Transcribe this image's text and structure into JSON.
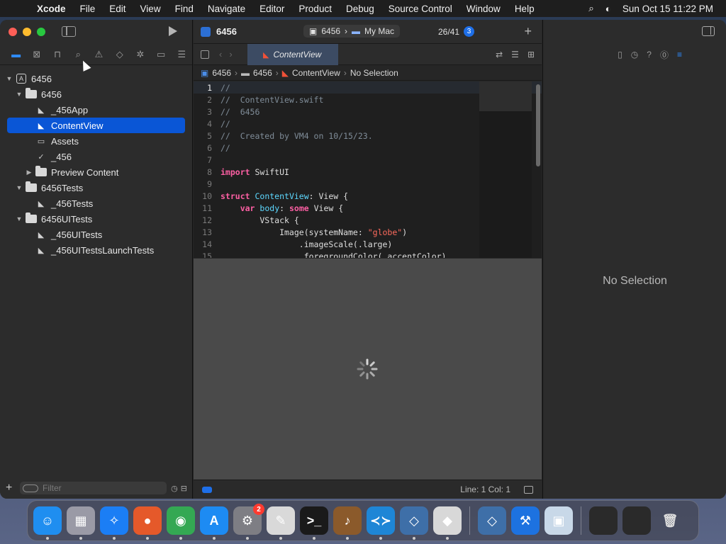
{
  "menubar": {
    "app": "Xcode",
    "items": [
      "File",
      "Edit",
      "View",
      "Find",
      "Navigate",
      "Editor",
      "Product",
      "Debug",
      "Source Control",
      "Window",
      "Help"
    ],
    "datetime": "Sun Oct 15  11:22 PM"
  },
  "navigator": {
    "tree": [
      {
        "label": "6456",
        "kind": "project",
        "level": 0,
        "expanded": true
      },
      {
        "label": "6456",
        "kind": "folder",
        "level": 1,
        "expanded": true
      },
      {
        "label": "_456App",
        "kind": "swift",
        "level": 2
      },
      {
        "label": "ContentView",
        "kind": "swift",
        "level": 2,
        "selected": true
      },
      {
        "label": "Assets",
        "kind": "assets",
        "level": 2
      },
      {
        "label": "_456",
        "kind": "entitlements",
        "level": 2
      },
      {
        "label": "Preview Content",
        "kind": "folder",
        "level": 2,
        "expanded": false
      },
      {
        "label": "6456Tests",
        "kind": "folder",
        "level": 1,
        "expanded": true
      },
      {
        "label": "_456Tests",
        "kind": "swift",
        "level": 2
      },
      {
        "label": "6456UITests",
        "kind": "folder",
        "level": 1,
        "expanded": true
      },
      {
        "label": "_456UITests",
        "kind": "swift",
        "level": 2
      },
      {
        "label": "_456UITestsLaunchTests",
        "kind": "swift",
        "level": 2
      }
    ],
    "filter_placeholder": "Filter"
  },
  "editor": {
    "project_name": "6456",
    "scheme": "6456",
    "destination": "My Mac",
    "counter": "26/41",
    "counter_badge": "3",
    "tab_label": "ContentView",
    "breadcrumb": [
      "6456",
      "6456",
      "ContentView",
      "No Selection"
    ],
    "code_lines": [
      [
        {
          "t": "//",
          "c": "c-com"
        }
      ],
      [
        {
          "t": "//  ContentView.swift",
          "c": "c-com"
        }
      ],
      [
        {
          "t": "//  6456",
          "c": "c-com"
        }
      ],
      [
        {
          "t": "//",
          "c": "c-com"
        }
      ],
      [
        {
          "t": "//  Created by VM4 on 10/15/23.",
          "c": "c-com"
        }
      ],
      [
        {
          "t": "//",
          "c": "c-com"
        }
      ],
      [],
      [
        {
          "t": "import",
          "c": "c-kw"
        },
        {
          "t": " SwiftUI",
          "c": "tx"
        }
      ],
      [],
      [
        {
          "t": "struct",
          "c": "c-kw"
        },
        {
          "t": " ",
          "c": "tx"
        },
        {
          "t": "ContentView",
          "c": "c-type"
        },
        {
          "t": ": View {",
          "c": "tx"
        }
      ],
      [
        {
          "t": "    ",
          "c": "tx"
        },
        {
          "t": "var",
          "c": "c-kw"
        },
        {
          "t": " ",
          "c": "tx"
        },
        {
          "t": "body",
          "c": "c-type"
        },
        {
          "t": ": ",
          "c": "tx"
        },
        {
          "t": "some",
          "c": "c-kw"
        },
        {
          "t": " View {",
          "c": "tx"
        }
      ],
      [
        {
          "t": "        VStack {",
          "c": "tx"
        }
      ],
      [
        {
          "t": "            Image(systemName: ",
          "c": "tx"
        },
        {
          "t": "\"globe\"",
          "c": "c-str"
        },
        {
          "t": ")",
          "c": "tx"
        }
      ],
      [
        {
          "t": "                .imageScale(.large)",
          "c": "tx"
        }
      ],
      [
        {
          "t": "                .foregroundColor(.accentColor)",
          "c": "tx"
        }
      ]
    ],
    "current_line": 1,
    "status": "Line: 1  Col: 1"
  },
  "inspector": {
    "empty_label": "No Selection"
  },
  "dock": {
    "apps": [
      {
        "name": "finder",
        "color": "#1f8ef0",
        "glyph": "☺"
      },
      {
        "name": "launchpad",
        "color": "#9a9aa6",
        "glyph": "▦"
      },
      {
        "name": "safari",
        "color": "#1b7ef5",
        "glyph": "✧"
      },
      {
        "name": "firefox",
        "color": "#e5592a",
        "glyph": "●"
      },
      {
        "name": "chrome",
        "color": "#34a853",
        "glyph": "◉"
      },
      {
        "name": "app-store",
        "color": "#1d8bf3",
        "glyph": "A"
      },
      {
        "name": "system-settings",
        "color": "#7e7e84",
        "glyph": "⚙",
        "badge": "2"
      },
      {
        "name": "textedit",
        "color": "#d9d9d9",
        "glyph": "✎"
      },
      {
        "name": "terminal",
        "color": "#1a1a1a",
        "glyph": ">_"
      },
      {
        "name": "instruments",
        "color": "#8b5a2b",
        "glyph": "♪"
      },
      {
        "name": "vscode",
        "color": "#1e86d6",
        "glyph": "≺≻"
      },
      {
        "name": "virtualbox",
        "color": "#3e6fa8",
        "glyph": "◇"
      },
      {
        "name": "roblox",
        "color": "#d8d8d8",
        "glyph": "◆"
      },
      {
        "name": "virtualbox-2",
        "color": "#3e6fa8",
        "glyph": "◇"
      },
      {
        "name": "xcode",
        "color": "#1d72e0",
        "glyph": "⚒"
      },
      {
        "name": "preview",
        "color": "#c8d8e8",
        "glyph": "▣"
      }
    ]
  }
}
